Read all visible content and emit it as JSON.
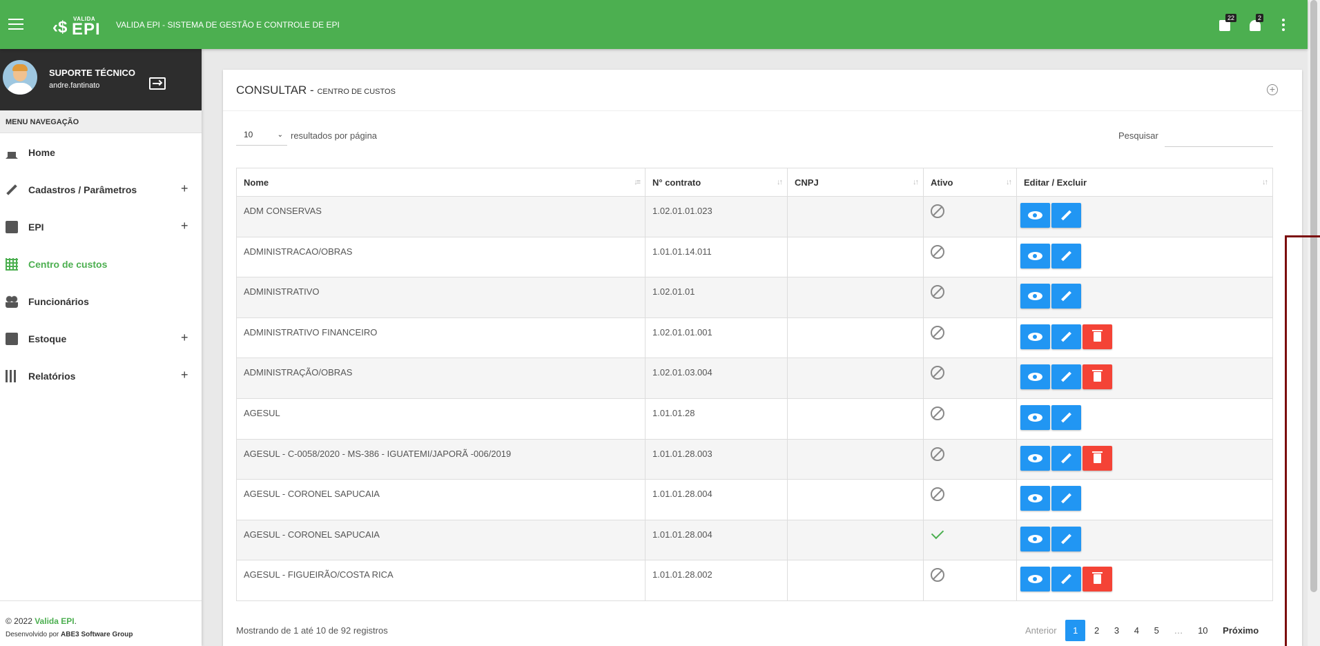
{
  "app": {
    "logo_small": "VALIDA",
    "logo_big": "EPI",
    "title": "VALIDA EPI - SISTEMA DE GESTÃO E CONTROLE DE EPI",
    "badge_1": "22",
    "badge_2": "2"
  },
  "user": {
    "name": "SUPORTE TÉCNICO",
    "login": "andre.fantinato"
  },
  "sidebar": {
    "header": "MENU NAVEGAÇÃO",
    "items": [
      {
        "label": "Home",
        "icon": "home-icon",
        "expandable": false
      },
      {
        "label": "Cadastros / Parâmetros",
        "icon": "pencil-icon",
        "expandable": true,
        "plus": "+"
      },
      {
        "label": "EPI",
        "icon": "clipboard-icon",
        "expandable": true,
        "plus": "+"
      },
      {
        "label": "Centro de custos",
        "icon": "grid-icon",
        "expandable": false,
        "active": true
      },
      {
        "label": "Funcionários",
        "icon": "people-icon",
        "expandable": false
      },
      {
        "label": "Estoque",
        "icon": "clipboard-check-icon",
        "expandable": true,
        "plus": "+"
      },
      {
        "label": "Relatórios",
        "icon": "chart-icon",
        "expandable": true,
        "plus": "+"
      }
    ],
    "footer": {
      "copyright": "© 2022 ",
      "brand": "Valida EPI",
      "dot": ".",
      "dev_prefix": "Desenvolvido por ",
      "dev_company": "ABE3 Software Group"
    }
  },
  "page": {
    "title": "CONSULTAR - ",
    "subtitle": "CENTRO DE CUSTOS",
    "length_value": "10",
    "length_label": "resultados por página",
    "search_label": "Pesquisar",
    "search_value": ""
  },
  "table": {
    "headers": [
      "Nome",
      "N° contrato",
      "CNPJ",
      "Ativo",
      "Editar / Excluir"
    ],
    "rows": [
      {
        "nome": "ADM CONSERVAS",
        "contrato": "1.02.01.01.023",
        "cnpj": "",
        "ativo": false,
        "delete": false
      },
      {
        "nome": "ADMINISTRACAO/OBRAS",
        "contrato": "1.01.01.14.011",
        "cnpj": "",
        "ativo": false,
        "delete": false
      },
      {
        "nome": "ADMINISTRATIVO",
        "contrato": "1.02.01.01",
        "cnpj": "",
        "ativo": false,
        "delete": false
      },
      {
        "nome": "ADMINISTRATIVO FINANCEIRO",
        "contrato": "1.02.01.01.001",
        "cnpj": "",
        "ativo": false,
        "delete": true
      },
      {
        "nome": "ADMINISTRAÇÃO/OBRAS",
        "contrato": "1.02.01.03.004",
        "cnpj": "",
        "ativo": false,
        "delete": true
      },
      {
        "nome": "AGESUL",
        "contrato": "1.01.01.28",
        "cnpj": "",
        "ativo": false,
        "delete": false
      },
      {
        "nome": "AGESUL - C-0058/2020 - MS-386 - IGUATEMI/JAPORÃ -006/2019",
        "contrato": "1.01.01.28.003",
        "cnpj": "",
        "ativo": false,
        "delete": true
      },
      {
        "nome": "AGESUL - CORONEL SAPUCAIA",
        "contrato": "1.01.01.28.004",
        "cnpj": "",
        "ativo": false,
        "delete": false
      },
      {
        "nome": "AGESUL - CORONEL SAPUCAIA",
        "contrato": "1.01.01.28.004",
        "cnpj": "",
        "ativo": true,
        "delete": false
      },
      {
        "nome": "AGESUL - FIGUEIRÃO/COSTA RICA",
        "contrato": "1.01.01.28.002",
        "cnpj": "",
        "ativo": false,
        "delete": true
      }
    ]
  },
  "footer": {
    "info": "Mostrando de 1 até 10 de 92 registros",
    "prev": "Anterior",
    "pages": [
      "1",
      "2",
      "3",
      "4",
      "5"
    ],
    "ellipsis": "…",
    "last": "10",
    "next": "Próximo",
    "current": "1"
  },
  "colors": {
    "primary": "#4caf50",
    "button_blue": "#2196f3",
    "button_red": "#f44336",
    "highlight": "#7b0c0c"
  }
}
